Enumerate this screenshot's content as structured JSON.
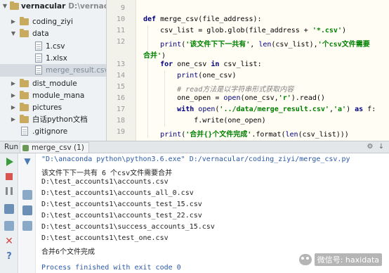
{
  "project_tree": {
    "root": {
      "name": "vernacular",
      "path": "D:\\vernacular"
    },
    "items": [
      {
        "label": "coding_ziyi",
        "type": "folder",
        "expanded": false
      },
      {
        "label": "data",
        "type": "folder",
        "expanded": true
      },
      {
        "label": "1.csv",
        "type": "file"
      },
      {
        "label": "1.xlsx",
        "type": "file"
      },
      {
        "label": "merge_result.csv",
        "type": "file",
        "selected": true
      },
      {
        "label": "dist_module",
        "type": "folder",
        "expanded": false
      },
      {
        "label": "module_mana",
        "type": "folder",
        "expanded": false
      },
      {
        "label": "pictures",
        "type": "folder",
        "expanded": false
      },
      {
        "label": "白话python文档",
        "type": "folder",
        "expanded": false
      },
      {
        "label": ".gitignore",
        "type": "file"
      }
    ]
  },
  "editor": {
    "line_numbers": [
      "9",
      "10",
      "11",
      "12",
      "",
      "13",
      "14",
      "15",
      "16",
      "17",
      "18",
      "19"
    ],
    "lines": [
      "",
      "def merge_csv(file_address):",
      "    csv_list = glob.glob(file_address + '*.csv')",
      "    print('该文件下下一共有', len(csv_list),'个csv文件需要",
      "合并')",
      "    for one_csv in csv_list:",
      "        print(one_csv)",
      "        # read方法是以字符串形式获取内容",
      "        one_open = open(one_csv,'r').read()",
      "        with open('../data/merge_result.csv','a') as f:",
      "            f.write(one_open)",
      "    print('合并{}个文件完成'.format(len(csv_list)))"
    ]
  },
  "run_panel": {
    "label": "Run",
    "tab": "merge_csv (1)",
    "output": [
      "\"D:\\anaconda python\\python3.6.exe\" D:/vernacular/coding_ziyi/merge_csv.py",
      "该文件下下一共有 6 个csv文件需要合并",
      "D:\\test_accounts1\\accounts.csv",
      "D:\\test_accounts1\\accounts_all_0.csv",
      "D:\\test_accounts1\\accounts_test_15.csv",
      "D:\\test_accounts1\\accounts_test_22.csv",
      "D:\\test_accounts1\\success_accounts_15.csv",
      "D:\\test_accounts1\\test_one.csv",
      "合并6个文件完成",
      "",
      "Process finished with exit code 0"
    ]
  },
  "watermark": {
    "text": "微信号: haxidata"
  }
}
